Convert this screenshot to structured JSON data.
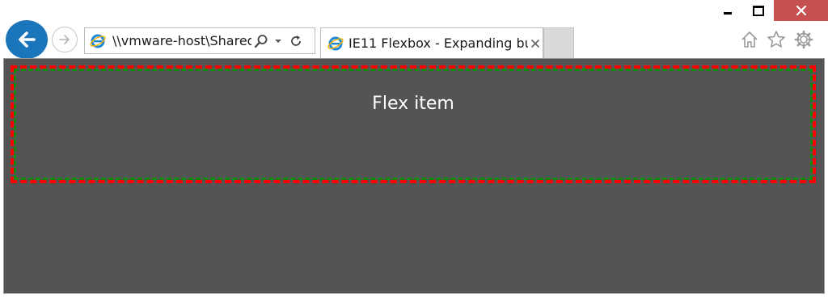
{
  "browser": {
    "address_bar": {
      "url": "\\\\vmware-host\\Shared"
    },
    "tabs": [
      {
        "title": "IE11 Flexbox - Expanding bu"
      }
    ],
    "icons": {
      "back": "back-arrow-icon",
      "forward": "forward-arrow-icon",
      "site": "ie-logo-icon",
      "search": "search-icon",
      "dropdown": "chevron-down-icon",
      "refresh": "refresh-icon",
      "close_tab": "close-icon",
      "home": "home-icon",
      "favorites": "star-icon",
      "tools": "gear-icon"
    },
    "colors": {
      "back_button": "#1b75bb",
      "close_button": "#c75050"
    }
  },
  "page": {
    "background": "#545454",
    "container_border_color": "#ff0000",
    "item_border_color": "#128a12",
    "flex_item_label": "Flex item"
  }
}
